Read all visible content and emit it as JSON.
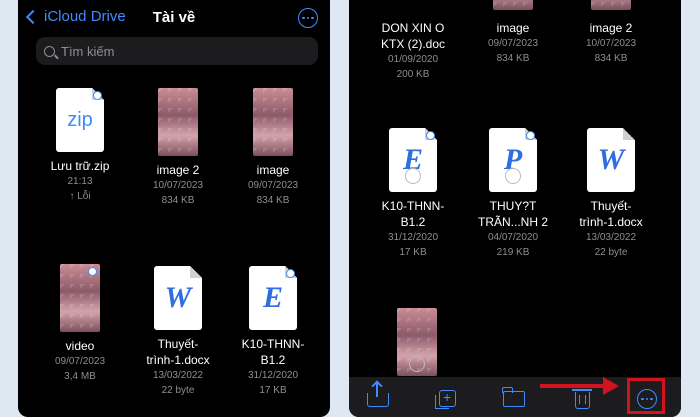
{
  "left": {
    "back_label": "iCloud Drive",
    "title": "Tài về",
    "search_placeholder": "Tìm kiếm",
    "files": [
      {
        "name1": "Lưu trữ.zip",
        "name2": "",
        "date": "21:13",
        "size": "↑ Lỗi",
        "kind": "zip",
        "letter": "zip"
      },
      {
        "name1": "image 2",
        "name2": "",
        "date": "10/07/2023",
        "size": "834 KB",
        "kind": "image"
      },
      {
        "name1": "image",
        "name2": "",
        "date": "09/07/2023",
        "size": "834 KB",
        "kind": "image"
      },
      {
        "name1": "video",
        "name2": "",
        "date": "09/07/2023",
        "size": "3,4 MB",
        "kind": "image"
      },
      {
        "name1": "Thuyết-",
        "name2": "trình-1.docx",
        "date": "13/03/2022",
        "size": "22 byte",
        "kind": "doc",
        "letter": "W"
      },
      {
        "name1": "K10-THNN-",
        "name2": "B1.2",
        "date": "31/12/2020",
        "size": "17 KB",
        "kind": "doc",
        "letter": "E"
      }
    ]
  },
  "right": {
    "files": [
      {
        "name1": "DON XIN O",
        "name2": "KTX (2).doc",
        "date": "01/09/2020",
        "size": "200 KB"
      },
      {
        "name1": "image",
        "name2": "",
        "date": "09/07/2023",
        "size": "834 KB"
      },
      {
        "name1": "image 2",
        "name2": "",
        "date": "10/07/2023",
        "size": "834 KB"
      },
      {
        "name1": "K10-THNN-",
        "name2": "B1.2",
        "date": "31/12/2020",
        "size": "17 KB",
        "kind": "doc",
        "letter": "E"
      },
      {
        "name1": "THUY?T",
        "name2": "TRÃN...NH 2",
        "date": "04/07/2020",
        "size": "219 KB",
        "kind": "doc",
        "letter": "P"
      },
      {
        "name1": "Thuyết-",
        "name2": "trình-1.docx",
        "date": "13/03/2022",
        "size": "22 byte",
        "kind": "doc",
        "letter": "W"
      }
    ]
  },
  "icons": {
    "share": "share-icon",
    "duplicate": "duplicate-icon",
    "folder": "folder-icon",
    "trash": "trash-icon",
    "more": "more-icon"
  },
  "colors": {
    "accent": "#3d8bff",
    "highlight": "#d0131f",
    "background": "#000000"
  }
}
